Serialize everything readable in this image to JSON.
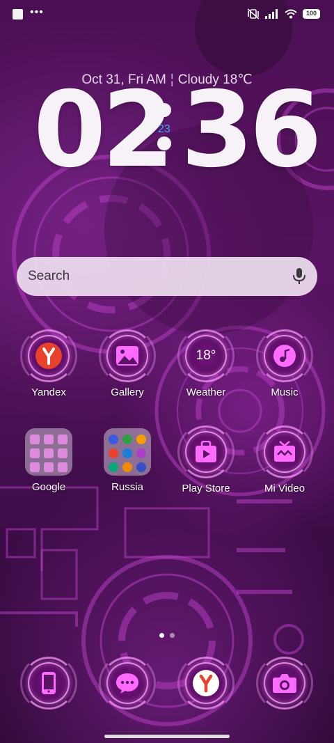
{
  "status_bar": {
    "battery": "100",
    "icons": [
      "notification-square-icon",
      "more-dots-icon",
      "vibrate-silent-icon",
      "signal-icon",
      "wifi-icon",
      "battery-icon"
    ]
  },
  "clock_widget": {
    "date": "Oct 31, Fri AM",
    "weather": "Cloudy 18℃",
    "hours": "02",
    "minutes": "36",
    "seconds": "23"
  },
  "search": {
    "placeholder": "Search",
    "icon": "microphone-icon"
  },
  "apps": {
    "row1": [
      {
        "label": "Yandex",
        "icon": "yandex-icon"
      },
      {
        "label": "Gallery",
        "icon": "gallery-icon"
      },
      {
        "label": "Weather",
        "icon": "weather-icon",
        "value": "18°"
      },
      {
        "label": "Music",
        "icon": "music-icon"
      }
    ],
    "row2": [
      {
        "label": "Google",
        "icon": "folder-icon"
      },
      {
        "label": "Russia",
        "icon": "folder-icon"
      },
      {
        "label": "Play Store",
        "icon": "play-store-icon"
      },
      {
        "label": "Mi Video",
        "icon": "mi-video-icon"
      }
    ]
  },
  "pages": {
    "count": 2,
    "active": 1
  },
  "dock": [
    {
      "icon": "phone-icon"
    },
    {
      "icon": "messages-icon"
    },
    {
      "icon": "yandex-browser-icon"
    },
    {
      "icon": "camera-icon"
    }
  ],
  "colors": {
    "accent_pink": "#ff6bff",
    "seconds_blue": "#3fa6ff",
    "yandex_red": "#e8412c",
    "background": "#4a0f52"
  }
}
